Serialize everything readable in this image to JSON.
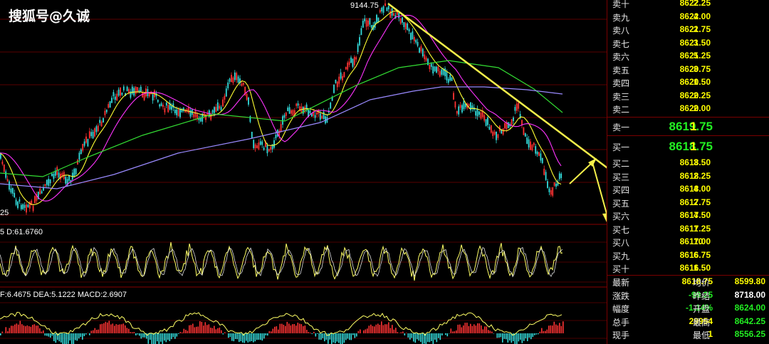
{
  "watermark": "搜狐号@久诚",
  "chart": {
    "peak_label": "9144.75",
    "low_label": "25",
    "kdj_label": "5 D:61.6760",
    "macd_label": "F:6.4675 DEA:5.1222 MACD:2.6907"
  },
  "sell_levels": [
    {
      "label": "卖十",
      "price": "8622.25",
      "vol": "2"
    },
    {
      "label": "卖九",
      "price": "8622.00",
      "vol": "4"
    },
    {
      "label": "卖八",
      "price": "8621.75",
      "vol": "2"
    },
    {
      "label": "卖七",
      "price": "8621.50",
      "vol": "3"
    },
    {
      "label": "卖六",
      "price": "8621.25",
      "vol": "5"
    },
    {
      "label": "卖五",
      "price": "8620.75",
      "vol": "3"
    },
    {
      "label": "卖四",
      "price": "8620.50",
      "vol": "1"
    },
    {
      "label": "卖三",
      "price": "8620.25",
      "vol": "2"
    },
    {
      "label": "卖二",
      "price": "8620.00",
      "vol": "2"
    }
  ],
  "best_ask": {
    "label": "卖一",
    "price": "8619.75",
    "vol": "1"
  },
  "best_bid": {
    "label": "买一",
    "price": "8618.75",
    "vol": "1"
  },
  "buy_levels": [
    {
      "label": "买二",
      "price": "8618.50",
      "vol": "3"
    },
    {
      "label": "买三",
      "price": "8618.25",
      "vol": "2"
    },
    {
      "label": "买四",
      "price": "8618.00",
      "vol": "4"
    },
    {
      "label": "买五",
      "price": "8617.75",
      "vol": "2"
    },
    {
      "label": "买六",
      "price": "8617.50",
      "vol": "4"
    },
    {
      "label": "买七",
      "price": "8617.25",
      "vol": "1"
    },
    {
      "label": "买八",
      "price": "8617.00",
      "vol": "10"
    },
    {
      "label": "买九",
      "price": "8616.75",
      "vol": "6"
    },
    {
      "label": "买十",
      "price": "8616.50",
      "vol": "1"
    }
  ],
  "stats": [
    {
      "l1": "最新",
      "v1": "8618.75",
      "c1": "#ffff00",
      "l2": "均价",
      "v2": "8599.80",
      "c2": "#ffff00"
    },
    {
      "l1": "涨跌",
      "v1": "-99.25",
      "c1": "#22ee22",
      "l2": "昨结",
      "v2": "8718.00",
      "c2": "#ffffff"
    },
    {
      "l1": "幅度",
      "v1": "-1.14%",
      "c1": "#22ee22",
      "l2": "开盘",
      "v2": "8624.00",
      "c2": "#22ee22"
    },
    {
      "l1": "总手",
      "v1": "29954",
      "c1": "#ffff00",
      "l2": "最高",
      "v2": "8642.25",
      "c2": "#22ee22"
    },
    {
      "l1": "现手",
      "v1": "1",
      "c1": "#ffff00",
      "l2": "最低",
      "v2": "8556.25",
      "c2": "#22ee22"
    }
  ],
  "colors": {
    "up_candle": "#ff3333",
    "down_candle": "#33dddd",
    "ma_yellow": "#ffff33",
    "ma_magenta": "#ff33ff",
    "ma_green": "#33dd33",
    "ma_lavender": "#9a8aff",
    "trend_line": "#f5f04a"
  }
}
